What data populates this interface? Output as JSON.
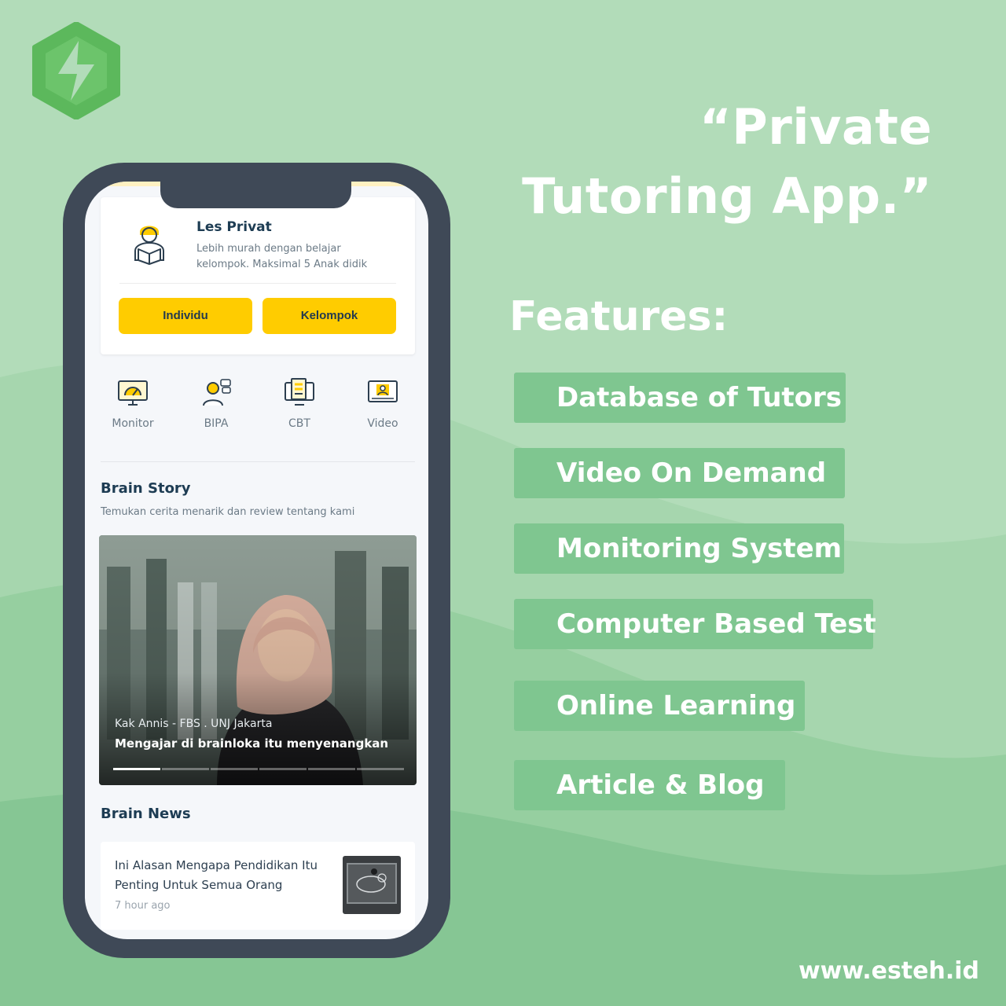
{
  "headline": {
    "line1": "“Private",
    "line2": "Tutoring App.”"
  },
  "features": {
    "title": "Features:",
    "items": [
      "Database of Tutors",
      "Video On Demand",
      "Monitoring System",
      "Computer Based Test",
      "Online Learning",
      "Article & Blog"
    ]
  },
  "website": "www.esteh.id",
  "app": {
    "card": {
      "title": "Les Privat",
      "description": "Lebih murah dengan belajar kelompok. Maksimal 5 Anak didik",
      "buttons": [
        "Individu",
        "Kelompok"
      ]
    },
    "menu": [
      {
        "label": "Monitor",
        "icon": "monitor-gauge-icon"
      },
      {
        "label": "BIPA",
        "icon": "tutor-chat-icon"
      },
      {
        "label": "CBT",
        "icon": "checklist-computer-icon"
      },
      {
        "label": "Video",
        "icon": "video-player-icon"
      }
    ],
    "brain_story": {
      "title": "Brain Story",
      "subtitle": "Temukan cerita menarik dan review tentang kami",
      "slide": {
        "meta": "Kak Annis - FBS . UNJ Jakarta",
        "caption": "Mengajar di brainloka itu menyenangkan"
      },
      "active_slide": 1,
      "slide_count": 6
    },
    "brain_news": {
      "title": "Brain News",
      "item": {
        "title": "Ini Alasan Mengapa Pendidikan Itu Penting Untuk Semua Orang",
        "time": "7 hour ago"
      }
    }
  },
  "colors": {
    "background": "#b2dcb9",
    "pill": "#7fc690",
    "logo": "#5cb85c",
    "accent_yellow": "#ffcc00",
    "phone_frame": "#3f4957",
    "text_dark": "#1d3c53"
  }
}
